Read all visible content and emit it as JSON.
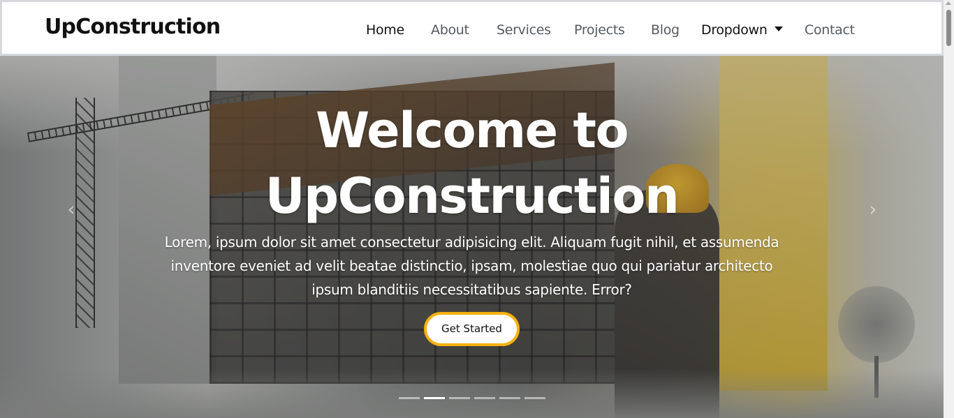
{
  "header": {
    "brand": "UpConstruction",
    "nav": [
      {
        "label": "Home",
        "active": true
      },
      {
        "label": "About"
      },
      {
        "label": "Services"
      },
      {
        "label": "Projects"
      },
      {
        "label": "Blog"
      },
      {
        "label": "Dropdown",
        "icon": "caret-down-icon"
      },
      {
        "label": "Contact"
      }
    ]
  },
  "hero": {
    "title_line1": "Welcome to",
    "title_line2": "UpConstruction",
    "text": "Lorem, ipsum dolor sit amet consectetur adipisicing elit. Aliquam fugit nihil, et assumenda inventore eveniet ad velit beatae distinctio, ipsam, molestiae quo qui pariatur architecto ipsum blanditiis necessitatibus sapiente. Error?",
    "cta_label": "Get Started",
    "prev_icon": "chevron-left-icon",
    "next_icon": "chevron-right-icon",
    "slide_count": 6,
    "active_slide": 2
  },
  "colors": {
    "accent": "#f6b10e",
    "text_dark": "#111111",
    "nav_text": "#555a60"
  }
}
